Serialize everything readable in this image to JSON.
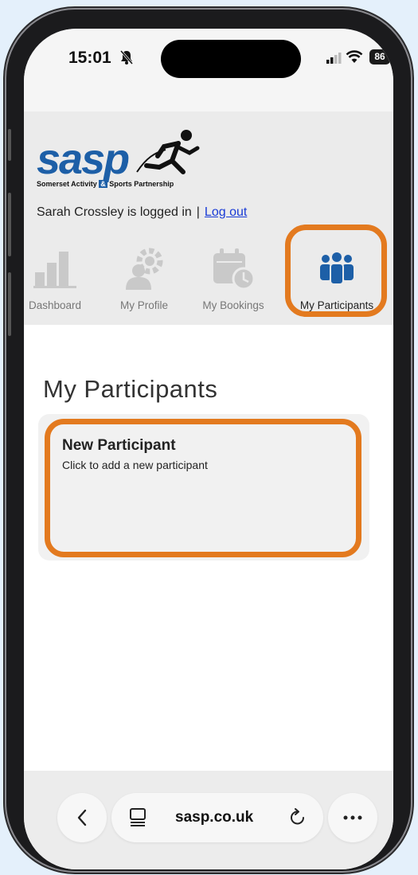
{
  "status_bar": {
    "time": "15:01",
    "battery": "86"
  },
  "site": {
    "logo_text": "sasp",
    "logo_sub_left": "Somerset Activity",
    "logo_sub_amp": "&",
    "logo_sub_right": "Sports Partnership",
    "login_text": "Sarah Crossley is logged in",
    "separator": "|",
    "logout_label": "Log out"
  },
  "nav": {
    "items": [
      {
        "label": "Dashboard",
        "icon": "bar-chart-icon"
      },
      {
        "label": "My Profile",
        "icon": "profile-gear-icon"
      },
      {
        "label": "My Bookings",
        "icon": "calendar-clock-icon"
      },
      {
        "label": "My Participants",
        "icon": "people-group-icon",
        "active": true
      }
    ]
  },
  "main": {
    "title": "My Participants",
    "card": {
      "title": "New Participant",
      "description": "Click to add a new participant"
    }
  },
  "browser": {
    "url": "sasp.co.uk"
  },
  "colors": {
    "highlight": "#e37a1f",
    "brand_blue": "#1d5fa7",
    "active_icon": "#1d5fa7",
    "inactive_icon": "#cfcfcf"
  }
}
